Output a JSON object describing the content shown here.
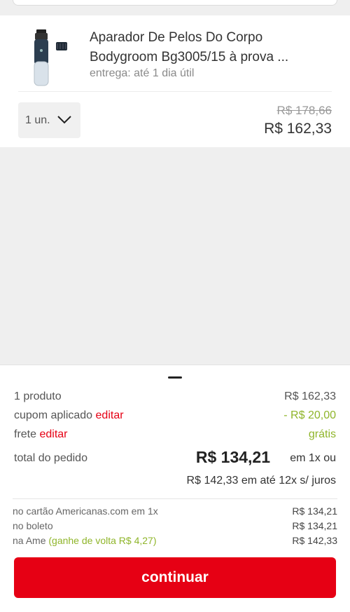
{
  "product": {
    "title": "Aparador De Pelos Do Corpo\nBodygroom Bg3005/15  à prova ...",
    "delivery": "entrega: até 1 dia útil",
    "quantity": "1 un.",
    "old_price": "R$ 178,66",
    "new_price": "R$ 162,33"
  },
  "summary": {
    "products_label": "1 produto",
    "products_value": "R$ 162,33",
    "coupon_label": "cupom aplicado",
    "coupon_edit": "editar",
    "coupon_value": "- R$ 20,00",
    "shipping_label": "frete",
    "shipping_edit": "editar",
    "shipping_value": "grátis",
    "total_label": "total do pedido",
    "total_value": "R$ 134,21",
    "total_suffix": "em 1x ou",
    "installments": "R$ 142,33 em até 12x s/ juros",
    "payment_options": [
      {
        "label": "no cartão Americanas.com em 1x",
        "extra": "",
        "value": "R$ 134,21"
      },
      {
        "label": "no boleto",
        "extra": "",
        "value": "R$ 134,21"
      },
      {
        "label": "na Ame",
        "extra": "(ganhe de volta R$ 4,27)",
        "value": "R$ 142,33"
      }
    ],
    "continue_label": "continuar"
  },
  "colors": {
    "accent": "#e60014",
    "cashback_green": "#8fb52a",
    "background": "#efefef"
  },
  "icons": {
    "quantity_dropdown": "chevron-down-icon",
    "product_image": "trimmer-product-image"
  }
}
